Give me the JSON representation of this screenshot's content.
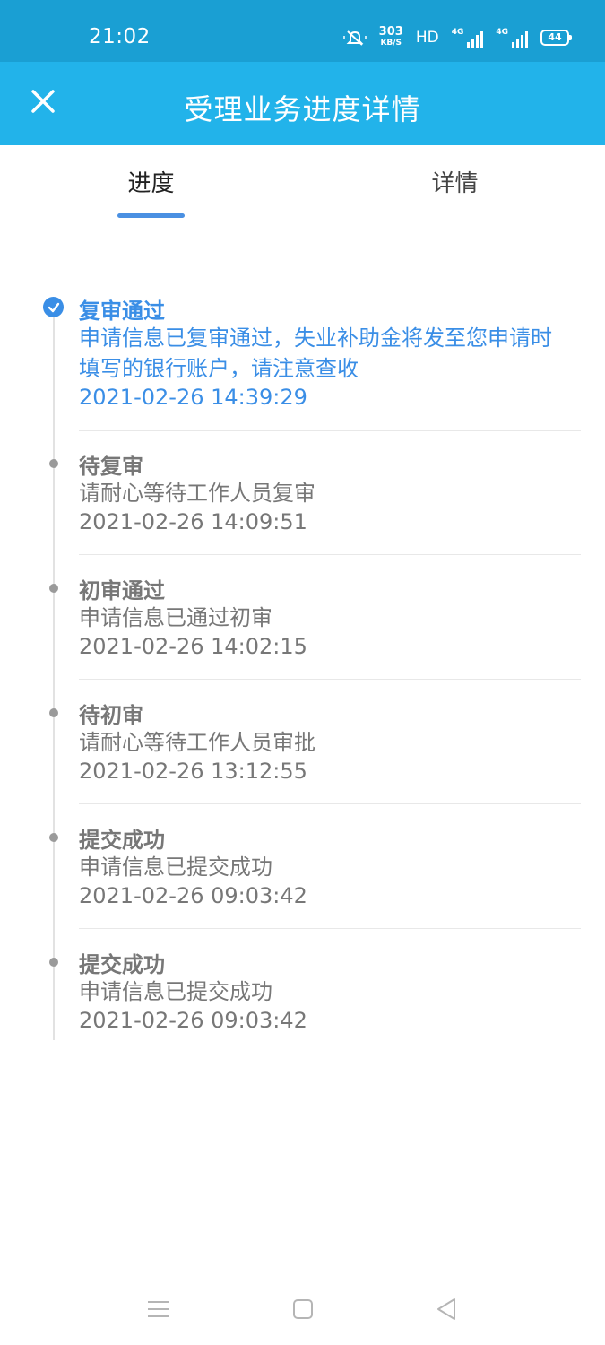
{
  "status_bar": {
    "time": "21:02",
    "net_speed": "303",
    "net_speed_unit": "KB/S",
    "hd_label": "HD",
    "network_1": "4G",
    "network_2": "4G",
    "battery": "44",
    "icons": [
      "mute-bell-icon",
      "signal-icon",
      "battery-icon"
    ]
  },
  "header": {
    "title": "受理业务进度详情",
    "close_icon": "close-icon"
  },
  "tabs": [
    {
      "label": "进度",
      "active": true
    },
    {
      "label": "详情",
      "active": false
    }
  ],
  "timeline": [
    {
      "title": "复审通过",
      "desc": "申请信息已复审通过，失业补助金将发至您申请时填写的银行账户，请注意查收",
      "time": "2021-02-26 14:39:29",
      "active": true
    },
    {
      "title": "待复审",
      "desc": "请耐心等待工作人员复审",
      "time": "2021-02-26 14:09:51",
      "active": false
    },
    {
      "title": "初审通过",
      "desc": "申请信息已通过初审",
      "time": "2021-02-26 14:02:15",
      "active": false
    },
    {
      "title": "待初审",
      "desc": "请耐心等待工作人员审批",
      "time": "2021-02-26 13:12:55",
      "active": false
    },
    {
      "title": "提交成功",
      "desc": "申请信息已提交成功",
      "time": "2021-02-26 09:03:42",
      "active": false
    },
    {
      "title": "提交成功",
      "desc": "申请信息已提交成功",
      "time": "2021-02-26 09:03:42",
      "active": false
    }
  ],
  "colors": {
    "status_bar": "#1a9fd3",
    "title_bar": "#22b3ea",
    "accent": "#3a8ee6",
    "muted_text": "#777777"
  },
  "nav_bar": {
    "icons": [
      "menu-icon",
      "home-square-icon",
      "back-triangle-icon"
    ]
  }
}
